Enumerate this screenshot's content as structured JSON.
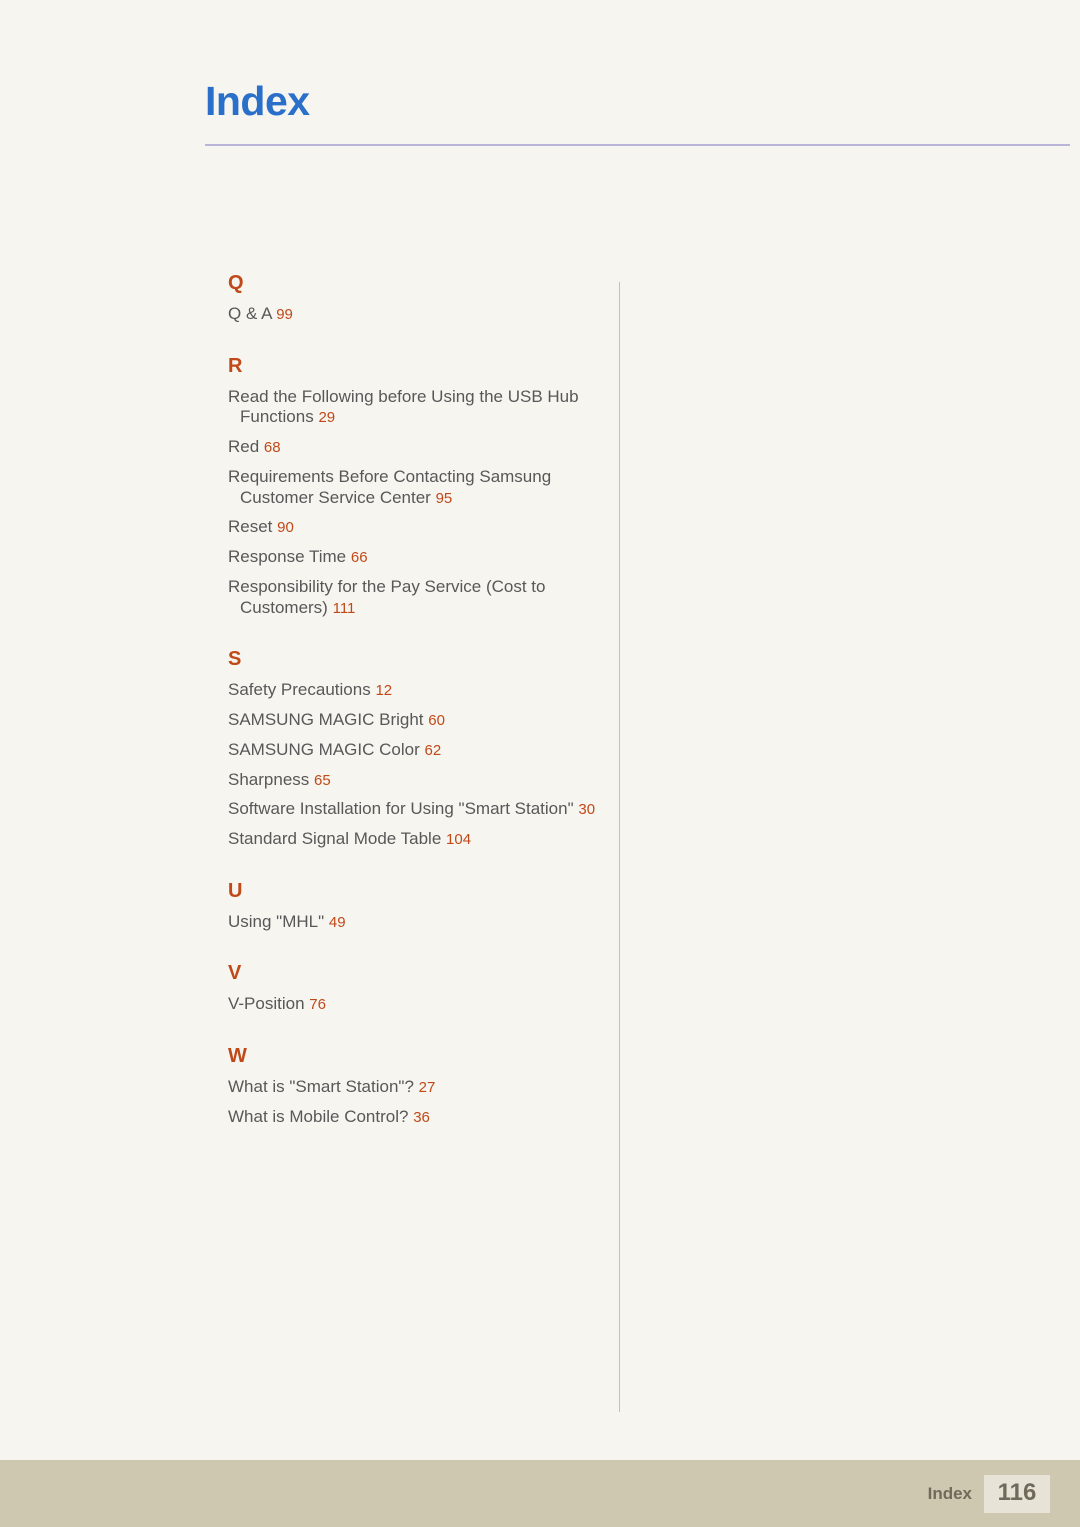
{
  "page": {
    "title": "Index",
    "footer_label": "Index",
    "footer_page_number": "116",
    "accent_title_color": "#2a6fc9",
    "accent_letter_color": "#c0491a",
    "text_color": "#585858",
    "background_color": "#f7f5ef",
    "band_color": "#cfc8b0"
  },
  "sections": [
    {
      "letter": "Q",
      "entries": [
        {
          "label": "Q & A",
          "page": "99"
        }
      ]
    },
    {
      "letter": "R",
      "entries": [
        {
          "label": "Read the Following before Using the USB Hub Functions",
          "page": "29"
        },
        {
          "label": "Red",
          "page": "68"
        },
        {
          "label": "Requirements Before Contacting Samsung Customer Service Center",
          "page": "95"
        },
        {
          "label": "Reset",
          "page": "90"
        },
        {
          "label": "Response Time",
          "page": "66"
        },
        {
          "label": "Responsibility for the Pay Service (Cost to Customers)",
          "page": "111"
        }
      ]
    },
    {
      "letter": "S",
      "entries": [
        {
          "label": "Safety Precautions",
          "page": "12"
        },
        {
          "label": "SAMSUNG MAGIC Bright",
          "page": "60"
        },
        {
          "label": "SAMSUNG MAGIC Color",
          "page": "62"
        },
        {
          "label": "Sharpness",
          "page": "65"
        },
        {
          "label": "Software Installation for Using \"Smart Station\"",
          "page": "30"
        },
        {
          "label": "Standard Signal Mode Table",
          "page": "104"
        }
      ]
    },
    {
      "letter": "U",
      "entries": [
        {
          "label": "Using \"MHL\"",
          "page": "49"
        }
      ]
    },
    {
      "letter": "V",
      "entries": [
        {
          "label": "V-Position",
          "page": "76"
        }
      ]
    },
    {
      "letter": "W",
      "entries": [
        {
          "label": "What is \"Smart Station\"?",
          "page": "27"
        },
        {
          "label": "What is Mobile Control?",
          "page": "36"
        }
      ]
    }
  ]
}
